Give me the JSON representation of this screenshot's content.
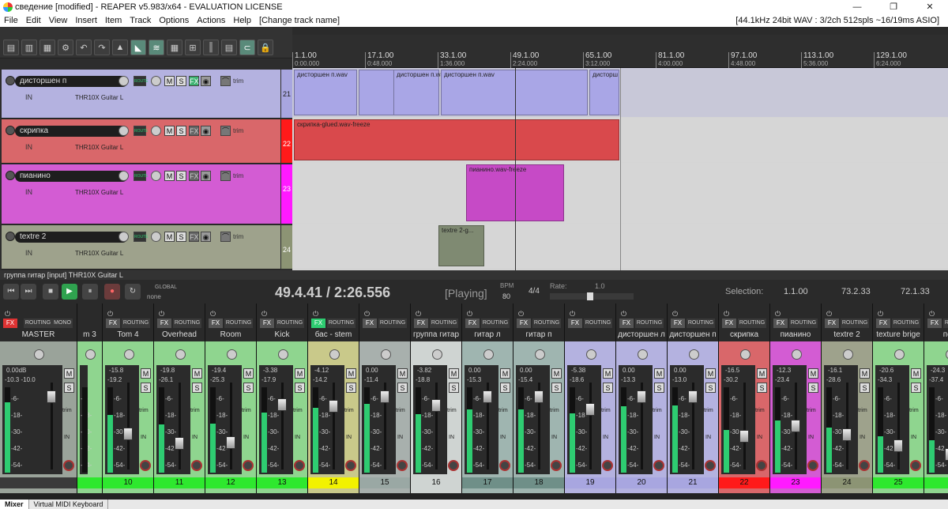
{
  "window": {
    "title": "сведение [modified] - REAPER v5.983/x64 - EVALUATION LICENSE",
    "controls": [
      "—",
      "❐",
      "✕"
    ]
  },
  "menu": {
    "items": [
      "File",
      "Edit",
      "View",
      "Insert",
      "Item",
      "Track",
      "Options",
      "Actions",
      "Help",
      "[Change track name]"
    ],
    "status": "[44.1kHz 24bit WAV : 3/2ch 512spls ~16/19ms ASIO]"
  },
  "toolbar": {
    "buttons": [
      "new",
      "open",
      "save",
      "settings",
      "undo",
      "redo",
      "metronome",
      "snap",
      "ripple",
      "grid",
      "lock",
      "env",
      "group",
      "xfade",
      "lockall"
    ]
  },
  "tracks": [
    {
      "name": "дисторшен п",
      "num": "21",
      "color": "#b4b2e0",
      "input": "IN",
      "fx": "THR10X Guitar L",
      "route": "ROUTE",
      "trim": "trim"
    },
    {
      "name": "скрипка",
      "num": "22",
      "color": "#d9676a",
      "input": "IN",
      "fx": "THR10X Guitar L",
      "route": "ROUTE",
      "trim": "trim"
    },
    {
      "name": "пианино",
      "num": "23",
      "color": "#d35cd3",
      "input": "IN",
      "fx": "THR10X Guitar L",
      "route": "ROUTE",
      "trim": "trim"
    },
    {
      "name": "textre 2",
      "num": "24",
      "color": "#9ea28c",
      "input": "IN",
      "fx": "THR10X Guitar L",
      "route": "ROUTE",
      "trim": "trim"
    }
  ],
  "ruler": [
    {
      "label": "1.1.00",
      "time": "0:00.000"
    },
    {
      "label": "17.1.00",
      "time": "0:48.000"
    },
    {
      "label": "33.1.00",
      "time": "1:36.000"
    },
    {
      "label": "49.1.00",
      "time": "2:24.000"
    },
    {
      "label": "65.1.00",
      "time": "3:12.000"
    },
    {
      "label": "81.1.00",
      "time": "4:00.000"
    },
    {
      "label": "97.1.00",
      "time": "4:48.000"
    },
    {
      "label": "113.1.00",
      "time": "5:36.000"
    },
    {
      "label": "129.1.00",
      "time": "6:24.000"
    }
  ],
  "items": {
    "distortion": [
      "дисторшен п.wav",
      "дисторшен п.wav",
      "дисторшен п.wav",
      "дисторш"
    ],
    "violin": "скрипка-glued.wav-freeze",
    "piano": "пианино.wav-freeze",
    "texture": "textre 2-g..."
  },
  "trackstatus": "группа гитар [input] THR10X Guitar L",
  "transport": {
    "time": "49.4.41 / 2:26.556",
    "state": "[Playing]",
    "bpm_label": "BPM",
    "bpm": "80",
    "sig": "4/4",
    "rate_label": "Rate:",
    "rate": "1.0",
    "global": "GLOBAL",
    "global_mode": "none",
    "selection_label": "Selection:",
    "sel_start": "1.1.00",
    "sel_end": "73.2.33",
    "sel_len": "72.1.33"
  },
  "mixer": {
    "labels": {
      "fx": "FX",
      "routing": "ROUTING",
      "mono": "MONO",
      "m": "M",
      "s": "S",
      "trim": "trim",
      "in": "IN"
    },
    "strips": [
      {
        "name": "MASTER",
        "num": "",
        "vol": "0.00dB",
        "peak": "-10.3 -10.0",
        "color": "#9aa39a",
        "numcolor": "#3a3a3a"
      },
      {
        "name": "m 3",
        "num": "",
        "vol": "",
        "peak": "",
        "color": "#8fd58f",
        "numcolor": "#2ee82e"
      },
      {
        "name": "Tom 4",
        "num": "10",
        "vol": "-15.8",
        "peak": "-19.2",
        "color": "#8fd58f",
        "numcolor": "#2ee82e"
      },
      {
        "name": "Overhead",
        "num": "11",
        "vol": "-19.8",
        "peak": "-26.1",
        "color": "#8fd58f",
        "numcolor": "#2ee82e"
      },
      {
        "name": "Room",
        "num": "12",
        "vol": "-19.4",
        "peak": "-25.3",
        "color": "#8fd58f",
        "numcolor": "#2ee82e"
      },
      {
        "name": "Kick",
        "num": "13",
        "vol": "-3.38",
        "peak": "-17.9",
        "color": "#8fd58f",
        "numcolor": "#2ee82e"
      },
      {
        "name": "бас - stem",
        "num": "14",
        "vol": "-4.12",
        "peak": "-14.2",
        "color": "#c9c98a",
        "numcolor": "#f2f200"
      },
      {
        "name": "",
        "num": "15",
        "vol": "0.00",
        "peak": "-11.4",
        "color": "#a8b0ad",
        "numcolor": "#9aa8a4"
      },
      {
        "name": "группа гитар",
        "num": "16",
        "vol": "-3.82",
        "peak": "-18.8",
        "color": "#cfd4d2",
        "numcolor": "#cfd4d2"
      },
      {
        "name": "гитар л",
        "num": "17",
        "vol": "0.00",
        "peak": "-15.3",
        "color": "#9fb5b0",
        "numcolor": "#6f8f88"
      },
      {
        "name": "гитар п",
        "num": "18",
        "vol": "0.00",
        "peak": "-15.4",
        "color": "#9fb5b0",
        "numcolor": "#6f8f88"
      },
      {
        "name": "",
        "num": "19",
        "vol": "-5.38",
        "peak": "-18.6",
        "color": "#b4b2e0",
        "numcolor": "#a8a6e0"
      },
      {
        "name": "дисторшен л",
        "num": "20",
        "vol": "0.00",
        "peak": "-13.3",
        "color": "#b4b2e0",
        "numcolor": "#a8a6e0"
      },
      {
        "name": "дисторшен п",
        "num": "21",
        "vol": "0.00",
        "peak": "-13.0",
        "color": "#b4b2e0",
        "numcolor": "#a8a6e0"
      },
      {
        "name": "скрипка",
        "num": "22",
        "vol": "-16.5",
        "peak": "-30.2",
        "color": "#d9676a",
        "numcolor": "#ff1a1a"
      },
      {
        "name": "пианино",
        "num": "23",
        "vol": "-12.3",
        "peak": "-23.4",
        "color": "#d35cd3",
        "numcolor": "#ff1aff"
      },
      {
        "name": "textre 2",
        "num": "24",
        "vol": "-16.1",
        "peak": "-28.6",
        "color": "#9ea28c",
        "numcolor": "#8c9474"
      },
      {
        "name": "texture brige",
        "num": "25",
        "vol": "-20.6",
        "peak": "-34.3",
        "color": "#8fd58f",
        "numcolor": "#2ee82e"
      },
      {
        "name": "пед",
        "num": "",
        "vol": "-24.3",
        "peak": "-37.4",
        "color": "#8fd58f",
        "numcolor": "#2ee82e"
      }
    ]
  },
  "bottomtabs": [
    "Mixer",
    "Virtual MIDI Keyboard"
  ]
}
